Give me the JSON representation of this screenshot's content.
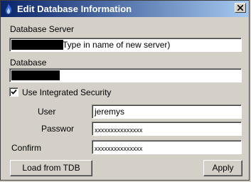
{
  "window": {
    "title": "Edit Database Information"
  },
  "fields": {
    "server_label": "Database Server",
    "server_value": "Type in name of new server)",
    "database_label": "Database",
    "integrated_security_label": "Use Integrated Security",
    "integrated_security_checked": true,
    "user_label": "User",
    "user_value": "jeremys",
    "password_label": "Passwor",
    "password_value": "xxxxxxxxxxxxxxx",
    "confirm_label": "Confirm",
    "confirm_value": "xxxxxxxxxxxxxxx"
  },
  "buttons": {
    "load": "Load from TDB",
    "apply": "Apply"
  },
  "icons": {
    "title": "flame-icon",
    "close": "close-icon",
    "check": "checkmark-icon"
  },
  "colors": {
    "titlebar_start": "#0a246a",
    "titlebar_end": "#a6caf0",
    "dialog_bg": "#d4d0c8"
  }
}
